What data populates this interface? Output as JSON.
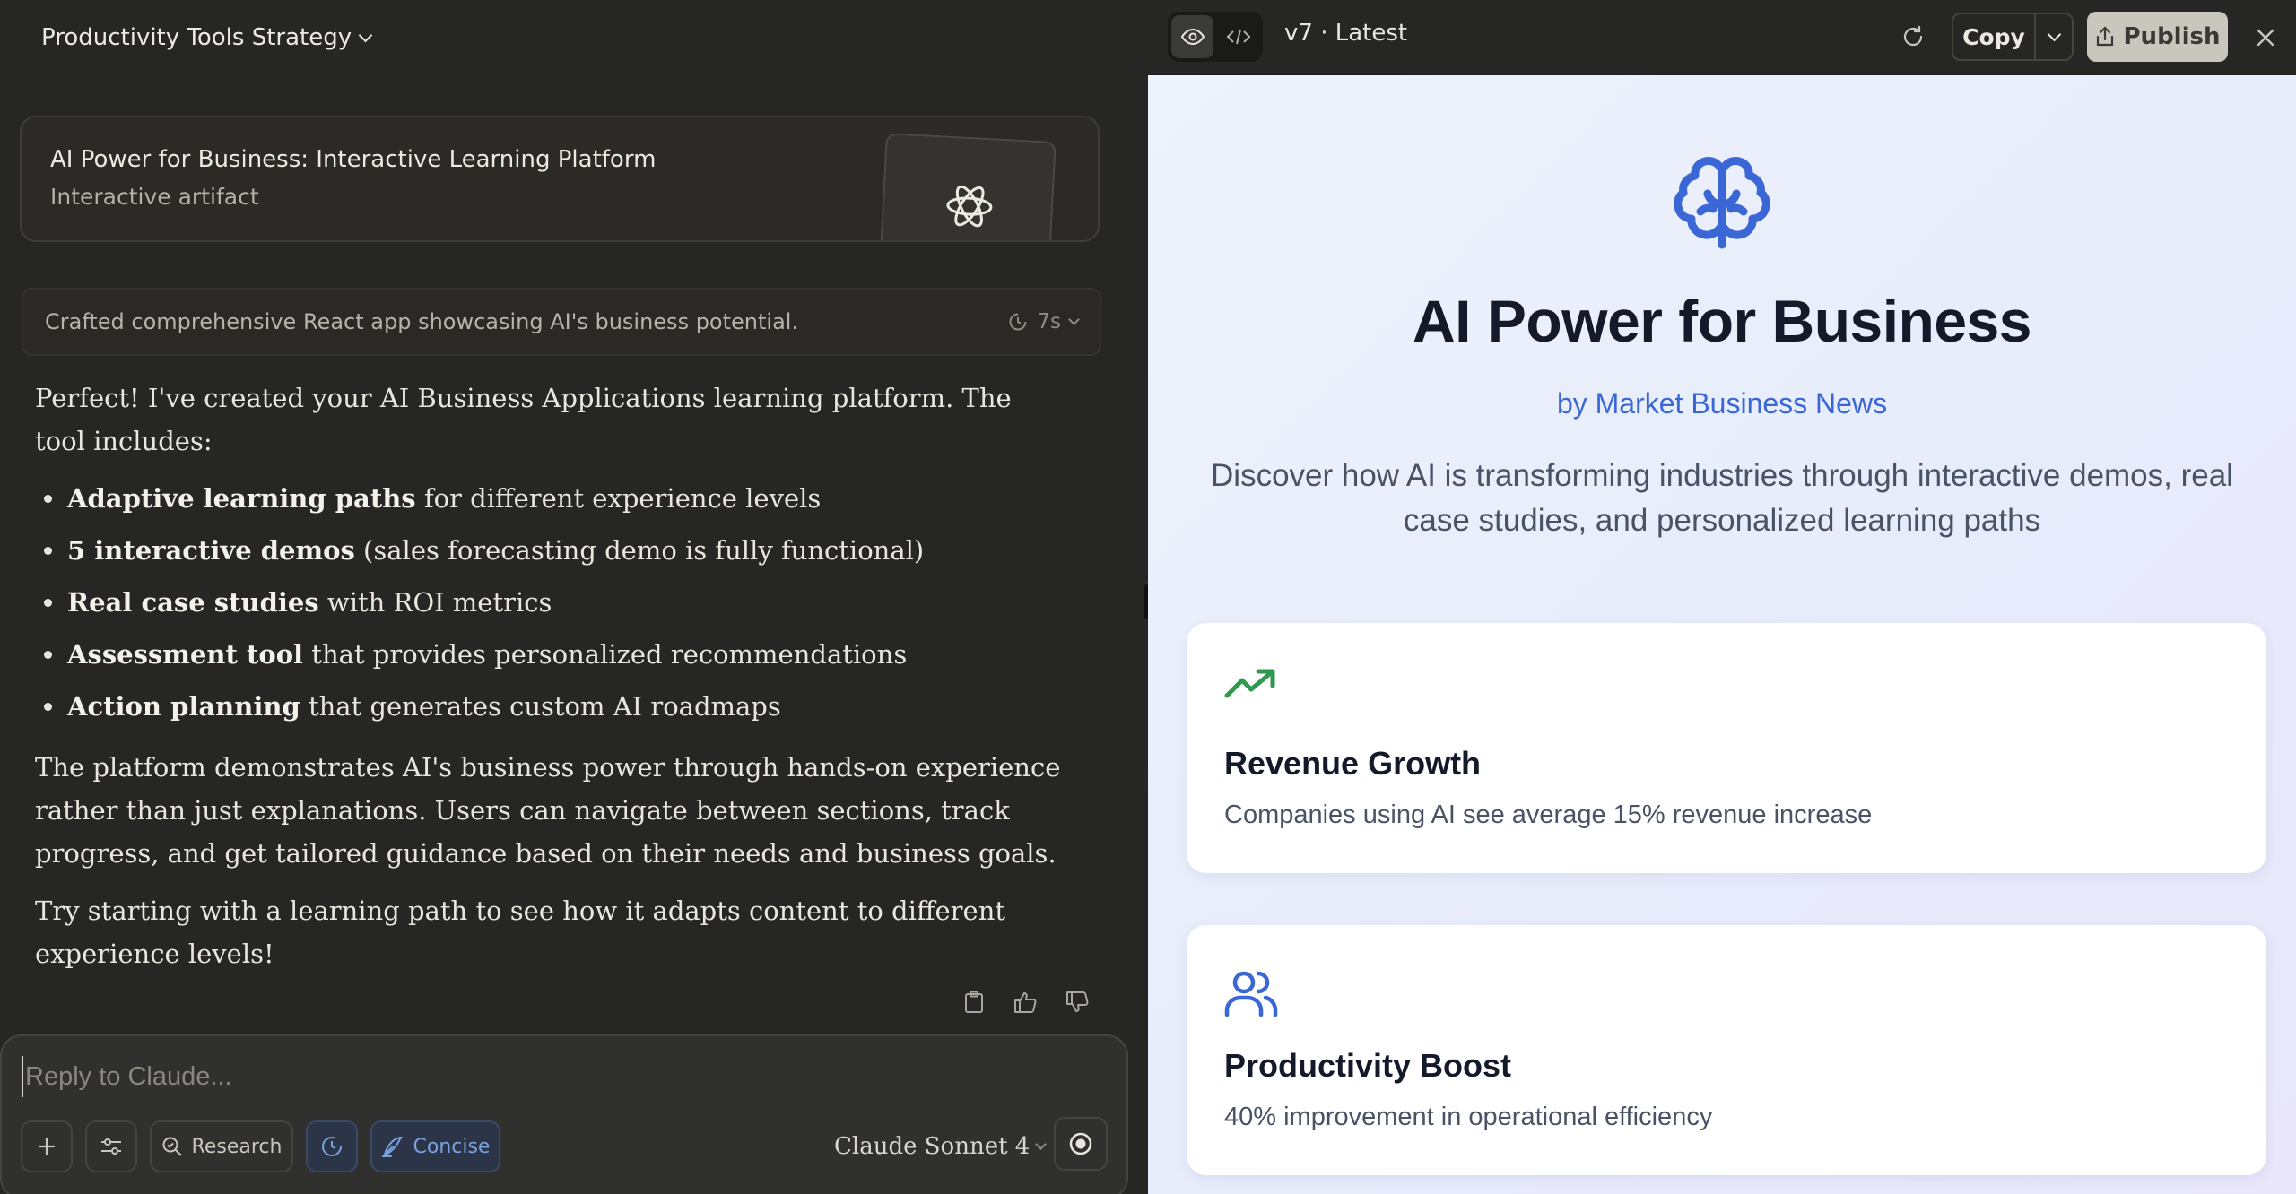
{
  "conversation": {
    "title": "Productivity Tools Strategy"
  },
  "artifact_card": {
    "title": "AI Power for Business: Interactive Learning Platform",
    "subtitle": "Interactive artifact",
    "thumb_icon": "react-atom-icon"
  },
  "thinking": {
    "summary": "Crafted comprehensive React app showcasing AI's business potential.",
    "duration": "7s"
  },
  "response": {
    "intro": "Perfect! I've created your AI Business Applications learning platform. The tool includes:",
    "bullets": [
      {
        "bold": "Adaptive learning paths",
        "rest": " for different experience levels"
      },
      {
        "bold": "5 interactive demos",
        "rest": " (sales forecasting demo is fully functional)"
      },
      {
        "bold": "Real case studies",
        "rest": " with ROI metrics"
      },
      {
        "bold": "Assessment tool",
        "rest": " that provides personalized recommendations"
      },
      {
        "bold": "Action planning",
        "rest": " that generates custom AI roadmaps"
      }
    ],
    "para2": "The platform demonstrates AI's business power through hands-on experience rather than just explanations. Users can navigate between sections, track progress, and get tailored guidance based on their needs and business goals.",
    "para3": "Try starting with a learning path to see how it adapts content to different experience levels!"
  },
  "composer": {
    "placeholder": "Reply to Claude...",
    "research_label": "Research",
    "concise_label": "Concise",
    "model": "Claude Sonnet 4"
  },
  "artifact_panel": {
    "version": "v7 · Latest",
    "copy_label": "Copy",
    "publish_label": "Publish",
    "hero": {
      "title": "AI Power for Business",
      "byline": "by Market Business News",
      "description": "Discover how AI is transforming industries through interactive demos, real case studies, and personalized learning paths"
    },
    "cards": [
      {
        "icon": "trending-up-icon",
        "title": "Revenue Growth",
        "desc": "Companies using AI see average 15% revenue increase",
        "color": "#2f9a4f"
      },
      {
        "icon": "users-icon",
        "title": "Productivity Boost",
        "desc": "40% improvement in operational efficiency",
        "color": "#3b66d6"
      }
    ]
  },
  "colors": {
    "accent_blue": "#3b66d6",
    "green": "#2f9a4f",
    "dark_bg": "#262624"
  }
}
